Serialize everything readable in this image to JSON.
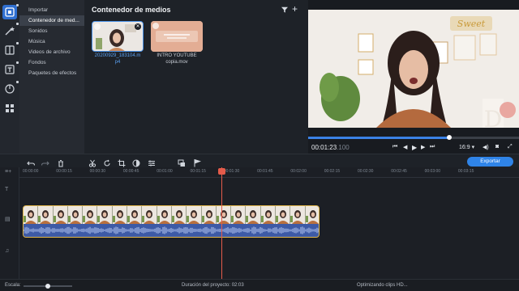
{
  "colors": {
    "accent": "#2f84e8",
    "clip_border": "#e3b84a",
    "playhead": "#e45b4a",
    "audio_wave": "#3d5aa6"
  },
  "tools": [
    {
      "icon": "media-import-icon",
      "active": true
    },
    {
      "icon": "magic-wand-icon",
      "active": false
    },
    {
      "icon": "transitions-icon",
      "active": false
    },
    {
      "icon": "titles-icon",
      "active": false
    },
    {
      "icon": "stickers-icon",
      "active": false
    },
    {
      "icon": "more-tools-icon",
      "active": false
    }
  ],
  "categories": [
    {
      "label": "Importar"
    },
    {
      "label": "Contenedor de med...",
      "selected": true
    },
    {
      "label": "Sonidos"
    },
    {
      "label": "Música"
    },
    {
      "label": "Videos de archivo"
    },
    {
      "label": "Fondos"
    },
    {
      "label": "Paquetes de efectos"
    }
  ],
  "media": {
    "title": "Contenedor de medios",
    "filter_icon": "filter-icon",
    "add_icon": "plus-icon",
    "items": [
      {
        "caption_line1": "20200929_183104.m",
        "caption_line2": "p4"
      },
      {
        "caption_line1": "INTRO YOUTUBE",
        "caption_line2": "copia.mov"
      }
    ]
  },
  "player": {
    "timecode_main": "00:01:23",
    "timecode_ms": ".100",
    "progress": 0.67,
    "aspect": "16:9 ▾",
    "controls": [
      "previous-icon",
      "step-back-icon",
      "play-icon",
      "step-forward-icon",
      "next-icon"
    ],
    "right_controls": [
      "volume-icon",
      "snapshot-icon",
      "fullscreen-icon"
    ]
  },
  "timeline_toolbar": {
    "tools": [
      "undo-icon",
      "redo-icon",
      "delete-icon",
      "cut-icon",
      "rotate-icon",
      "crop-icon",
      "color-icon",
      "clip-properties-icon",
      "overlay-icon",
      "marker-icon"
    ],
    "export_label": "Exportar"
  },
  "ruler": {
    "ticks": [
      "00:00:00",
      "00:00:15",
      "00:00:30",
      "00:00:45",
      "00:01:00",
      "00:01:15",
      "00:01:30",
      "00:01:45",
      "00:02:00",
      "00:02:15",
      "00:02:30",
      "00:02:45",
      "00:03:00",
      "00:03:15"
    ]
  },
  "timeline": {
    "playhead_fraction": 0.5,
    "frame_count": 20
  },
  "status": {
    "scale_label": "Escala:",
    "scale_value": 0.5,
    "duration": "Duración del proyecto:  02:03",
    "optimizing": "Optimizando clips HD..."
  }
}
